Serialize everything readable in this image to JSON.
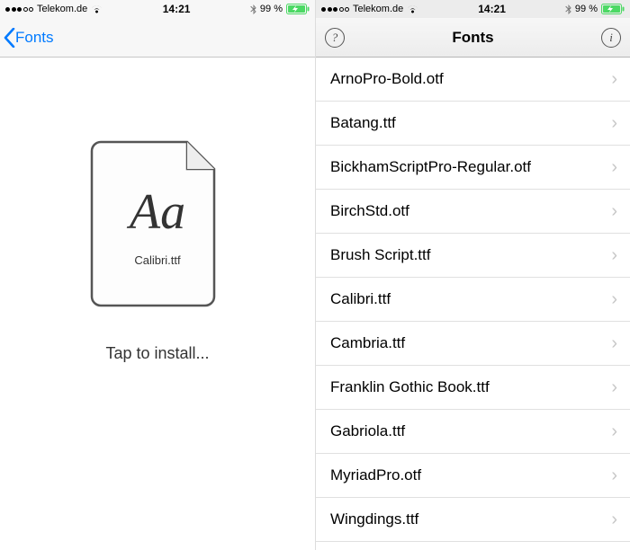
{
  "status": {
    "carrier": "Telekom.de",
    "time": "14:21",
    "battery_text": "99 %",
    "signal_filled": 3,
    "signal_total": 5
  },
  "left": {
    "back_label": "Fonts",
    "file_label": "Calibri.ttf",
    "preview_glyphs": "Aa",
    "caption": "Tap to install..."
  },
  "right": {
    "title": "Fonts",
    "help_glyph": "?",
    "info_glyph": "i",
    "items": [
      {
        "name": "ArnoPro-Bold.otf"
      },
      {
        "name": "Batang.ttf"
      },
      {
        "name": "BickhamScriptPro-Regular.otf"
      },
      {
        "name": "BirchStd.otf"
      },
      {
        "name": "Brush Script.ttf"
      },
      {
        "name": "Calibri.ttf"
      },
      {
        "name": "Cambria.ttf"
      },
      {
        "name": "Franklin Gothic Book.ttf"
      },
      {
        "name": "Gabriola.ttf"
      },
      {
        "name": "MyriadPro.otf"
      },
      {
        "name": "Wingdings.ttf"
      }
    ]
  }
}
